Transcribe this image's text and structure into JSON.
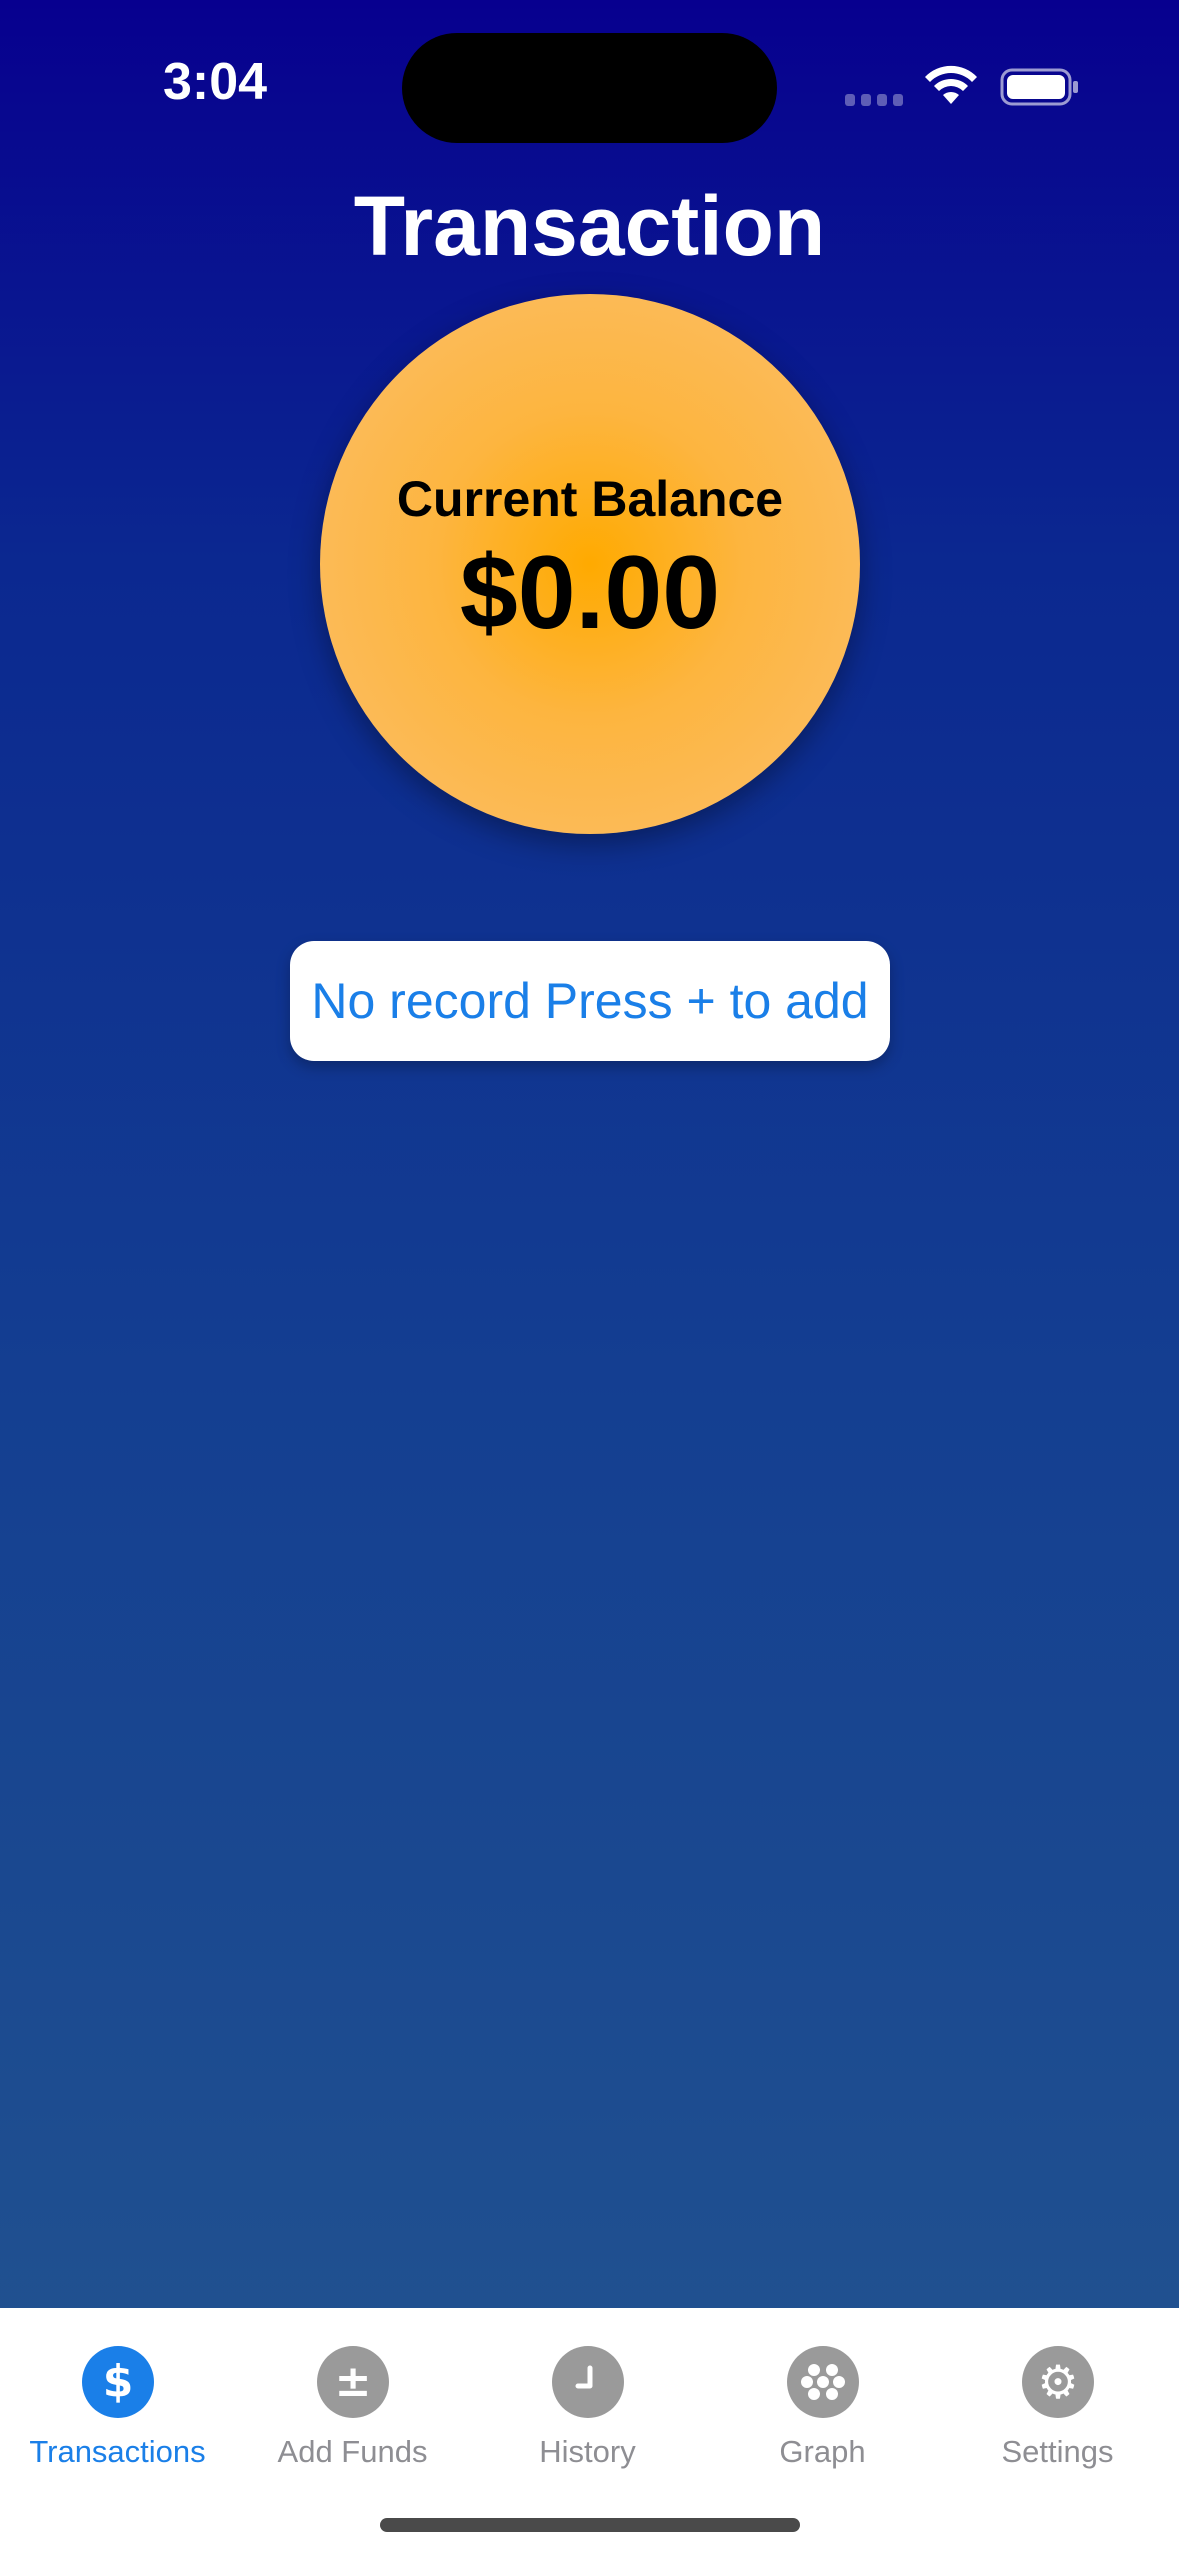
{
  "status_bar": {
    "time": "3:04"
  },
  "header": {
    "title": "Transaction"
  },
  "balance": {
    "label": "Current Balance",
    "value": "$0.00"
  },
  "empty_state": {
    "message": "No record Press + to add"
  },
  "tab_bar": {
    "tabs": [
      {
        "label": "Transactions",
        "icon": "dollar-icon",
        "active": true
      },
      {
        "label": "Add Funds",
        "icon": "plus-minus-icon",
        "active": false
      },
      {
        "label": "History",
        "icon": "clock-icon",
        "active": false
      },
      {
        "label": "Graph",
        "icon": "dots-grid-icon",
        "active": false
      },
      {
        "label": "Settings",
        "icon": "gear-icon",
        "active": false
      }
    ]
  },
  "colors": {
    "background_top": "#07008f",
    "background_bottom": "#23558f",
    "balance_circle": "#ffaa00",
    "accent_blue": "#1a7fe8",
    "inactive_gray": "#8e8e93"
  }
}
